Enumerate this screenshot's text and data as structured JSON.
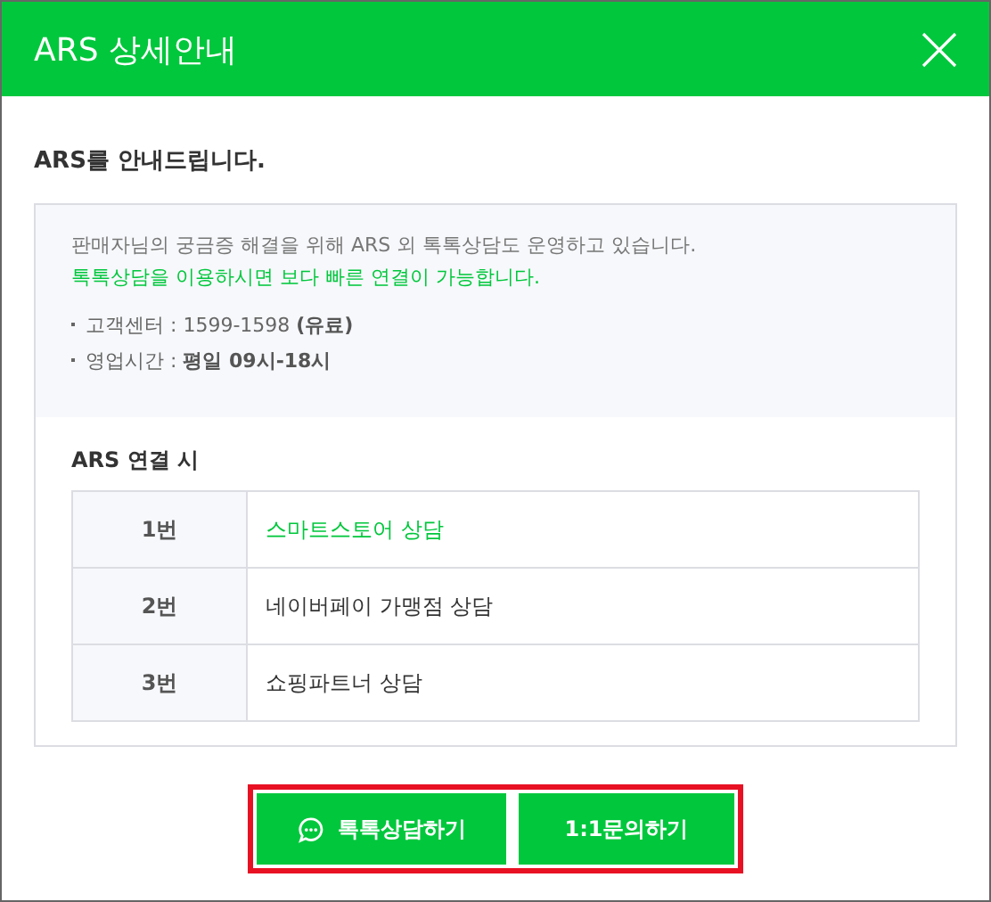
{
  "window": {
    "title": "ARS 상세안내"
  },
  "heading": "ARS를 안내드립니다.",
  "info": {
    "lines": [
      {
        "kind": "plain",
        "text": "판매자님의 궁금증 해결을 위해 ARS 외 톡톡상담도 운영하고 있습니다."
      },
      {
        "kind": "emphasis",
        "text": "톡톡상담을 이용하시면 보다 빠른 연결이 가능합니다."
      }
    ],
    "bullets": [
      "고객센터 : 1599-1598 **(유료)**",
      "영업시간 : **평일 09시-18시**"
    ]
  },
  "ars": {
    "title": "ARS 연결 시",
    "rows": [
      {
        "number": "1번",
        "label": "스마트스토어 상담",
        "color": "#00c73c"
      },
      {
        "number": "2번",
        "label": "네이버페이 가맹점 상담",
        "color": "#333333"
      },
      {
        "number": "3번",
        "label": "쇼핑파트너 상담",
        "color": "#333333"
      }
    ]
  },
  "actions": {
    "highlighted": true,
    "buttons": [
      {
        "kind": "chat",
        "label": "톡톡상담하기"
      },
      {
        "kind": "plain",
        "label": "1:1문의하기"
      }
    ]
  }
}
